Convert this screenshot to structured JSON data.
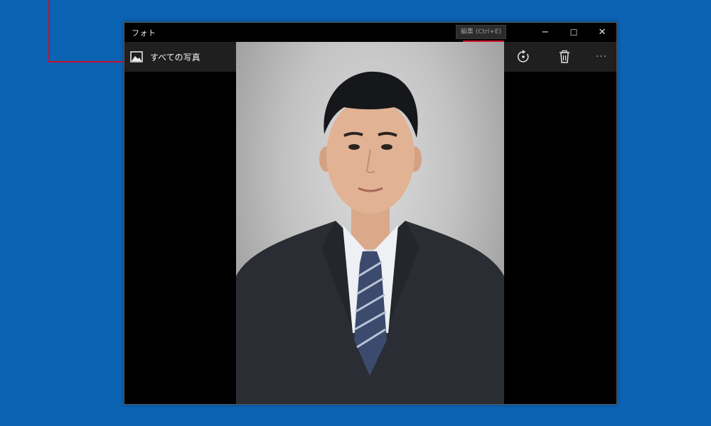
{
  "window": {
    "title": "フォト",
    "minimize_glyph": "−",
    "maximize_glyph": "☐",
    "close_glyph": "✕"
  },
  "tooltip": {
    "text": "編集 (Ctrl+E)"
  },
  "toolbar": {
    "back_label": "すべての写真",
    "back_icon": "photo-icon",
    "buttons": [
      {
        "name": "people-icon"
      },
      {
        "name": "slideshow-icon"
      },
      {
        "name": "edit-pencil-icon"
      },
      {
        "name": "rotate-icon"
      },
      {
        "name": "delete-icon"
      },
      {
        "name": "more-icon",
        "glyph": "···"
      }
    ]
  },
  "photo": {
    "subject": "portrait"
  },
  "colors": {
    "desktop": "#0c63b4",
    "highlight": "#d0122a",
    "toolbar": "#1f1f1f"
  }
}
